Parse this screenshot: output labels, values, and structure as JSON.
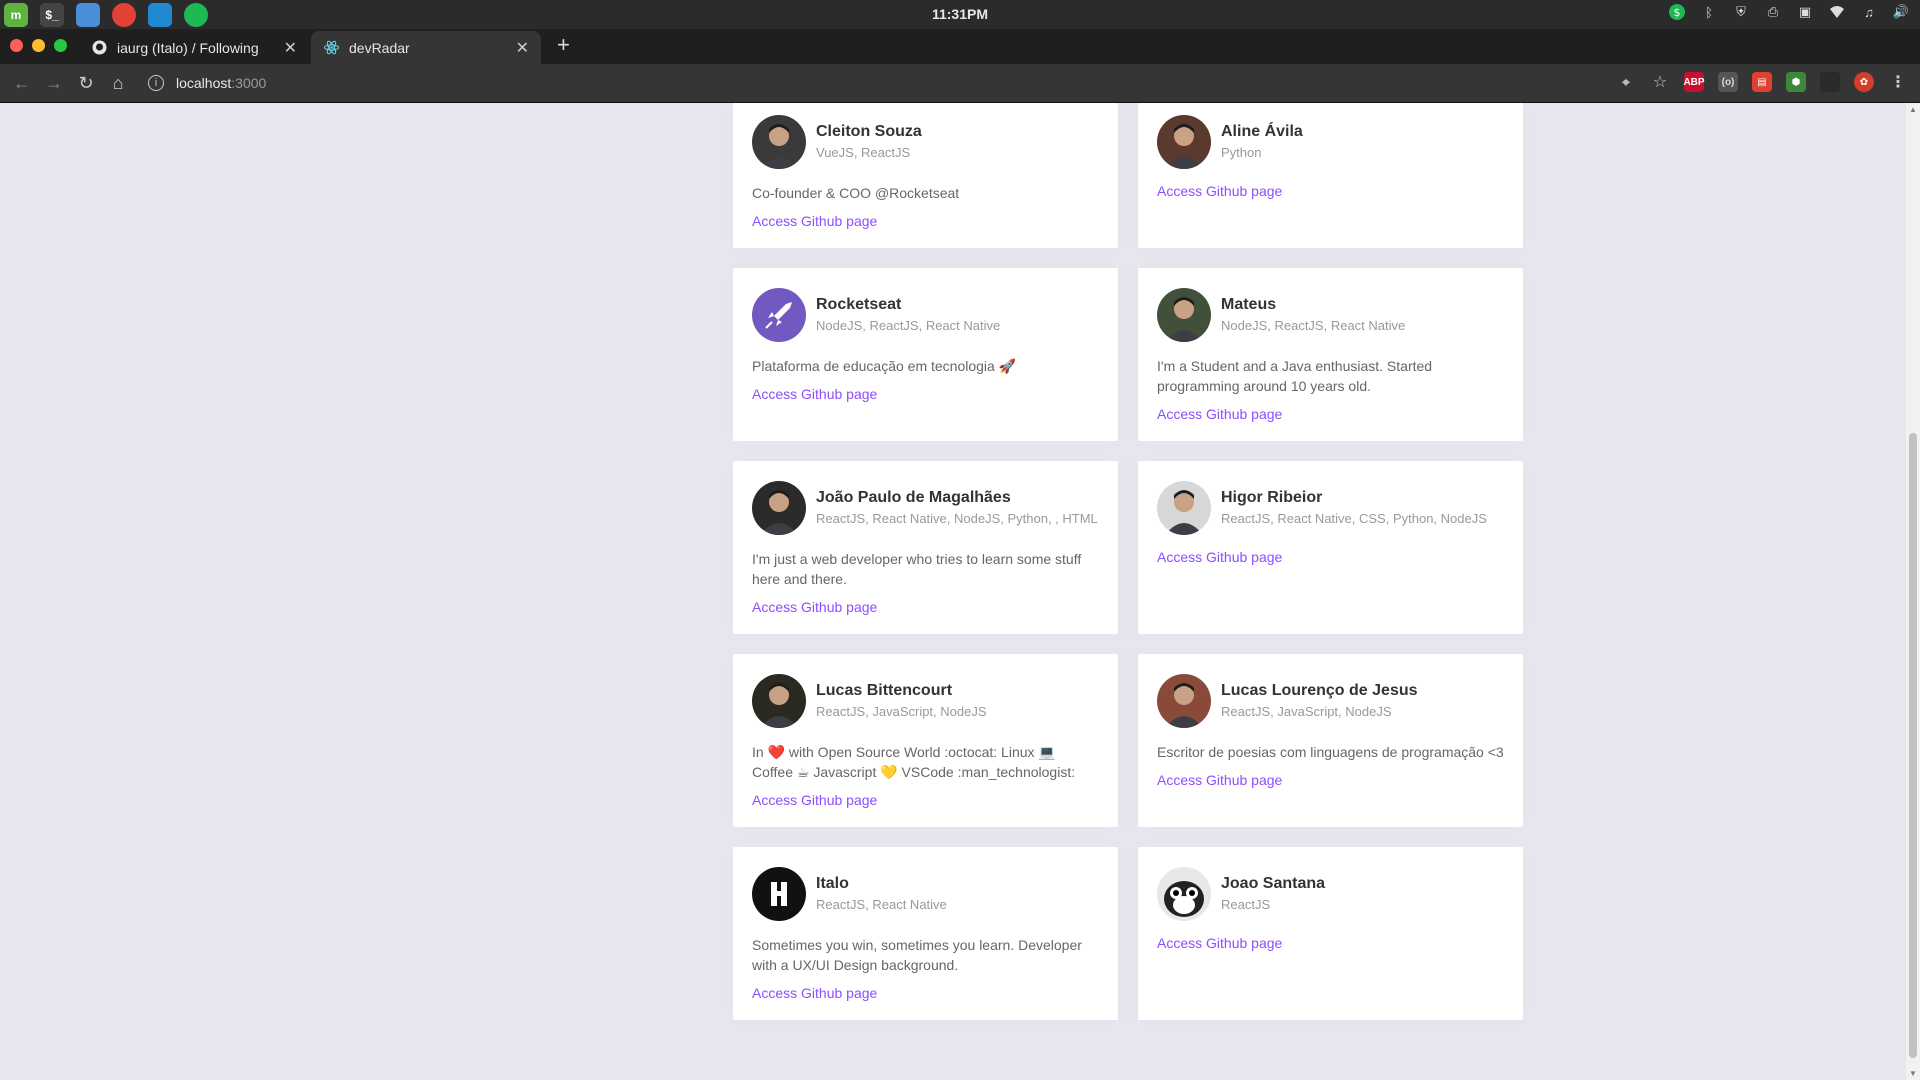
{
  "os": {
    "clock": "11:31PM",
    "apps": [
      {
        "name": "mint-menu-icon",
        "glyph": "m",
        "bg": "#5fb340"
      },
      {
        "name": "terminal-icon",
        "glyph": "$_",
        "bg": "#444"
      },
      {
        "name": "files-icon",
        "glyph": "",
        "bg": "#4a8fd6"
      },
      {
        "name": "chrome-icon",
        "glyph": "",
        "bg": "#e34133"
      },
      {
        "name": "vscode-icon",
        "glyph": "",
        "bg": "#1f8ad2"
      },
      {
        "name": "spotify-icon",
        "glyph": "",
        "bg": "#1db954"
      }
    ]
  },
  "browser": {
    "tabs": [
      {
        "title": "iaurg (Italo) / Following",
        "favicon": "github-icon",
        "active": false
      },
      {
        "title": "devRadar",
        "favicon": "react-icon",
        "active": true
      }
    ],
    "url": {
      "host": "localhost",
      "port": ":3000"
    }
  },
  "page": {
    "link_label": "Access Github page",
    "devs": [
      {
        "name": "Cleiton Souza",
        "techs": "VueJS, ReactJS",
        "bio": "Co-founder & COO @Rocketseat",
        "avatar_bg": "#3a3a3a",
        "avatar": "person"
      },
      {
        "name": "Aline Ávila",
        "techs": "Python",
        "bio": "",
        "avatar_bg": "#5a3a2c",
        "avatar": "person"
      },
      {
        "name": "Rocketseat",
        "techs": "NodeJS, ReactJS, React Native",
        "bio": "Plataforma de educação em tecnologia 🚀",
        "avatar_bg": "#7159c1",
        "avatar": "rocket"
      },
      {
        "name": "Mateus",
        "techs": "NodeJS, ReactJS, React Native",
        "bio": "I'm a Student and a Java enthusiast. Started programming around 10 years old.",
        "avatar_bg": "#41503a",
        "avatar": "person"
      },
      {
        "name": "João Paulo de Magalhães",
        "techs": "ReactJS, React Native, NodeJS, Python, , HTML",
        "bio": "I'm just a web developer who tries to learn some stuff here and there.",
        "avatar_bg": "#2b2b2b",
        "avatar": "person"
      },
      {
        "name": "Higor Ribeior",
        "techs": "ReactJS, React Native, CSS, Python, NodeJS",
        "bio": "",
        "avatar_bg": "#d8d8d8",
        "avatar": "person"
      },
      {
        "name": "Lucas Bittencourt",
        "techs": "ReactJS, JavaScript, NodeJS",
        "bio": "In ❤️ with Open Source World :octocat: Linux 💻 Coffee ☕ Javascript 💛 VSCode :man_technologist:",
        "avatar_bg": "#2a2a22",
        "avatar": "person"
      },
      {
        "name": "Lucas Lourenço de Jesus",
        "techs": "ReactJS, JavaScript, NodeJS",
        "bio": "Escritor de poesias com linguagens de programação <3",
        "avatar_bg": "#8a4a3a",
        "avatar": "person"
      },
      {
        "name": "Italo",
        "techs": "ReactJS, React Native",
        "bio": "Sometimes you win, sometimes you learn. Developer with a UX/UI Design background.",
        "avatar_bg": "#111111",
        "avatar": "logo"
      },
      {
        "name": "Joao Santana",
        "techs": "ReactJS",
        "bio": "",
        "avatar_bg": "#e8e8e8",
        "avatar": "cat"
      }
    ]
  }
}
